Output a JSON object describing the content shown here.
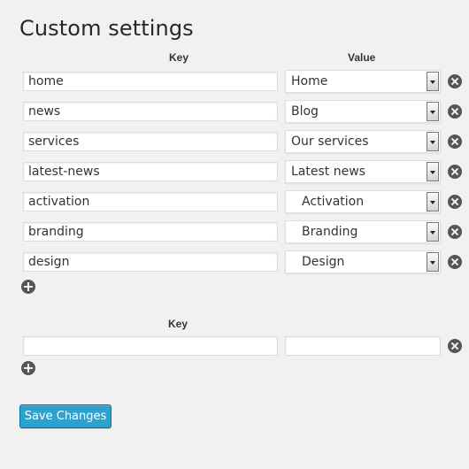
{
  "page": {
    "title": "Custom settings"
  },
  "mappings": {
    "key_header": "Key",
    "value_header": "Value",
    "rows": [
      {
        "key": "home",
        "value": "Home",
        "indent": false
      },
      {
        "key": "news",
        "value": "Blog",
        "indent": false
      },
      {
        "key": "services",
        "value": "Our services",
        "indent": false
      },
      {
        "key": "latest-news",
        "value": "Latest news",
        "indent": false
      },
      {
        "key": "activation",
        "value": "Activation",
        "indent": true
      },
      {
        "key": "branding",
        "value": "Branding",
        "indent": true
      },
      {
        "key": "design",
        "value": "Design",
        "indent": true
      }
    ]
  },
  "extra": {
    "key_header": "Key",
    "rows": [
      {
        "key": "",
        "value": ""
      }
    ]
  },
  "actions": {
    "save_label": "Save Changes"
  },
  "icons": {
    "remove": "remove-circle-icon",
    "add": "add-circle-icon"
  },
  "colors": {
    "primary_button": "#2ea2cc",
    "background": "#f1f1f1"
  }
}
